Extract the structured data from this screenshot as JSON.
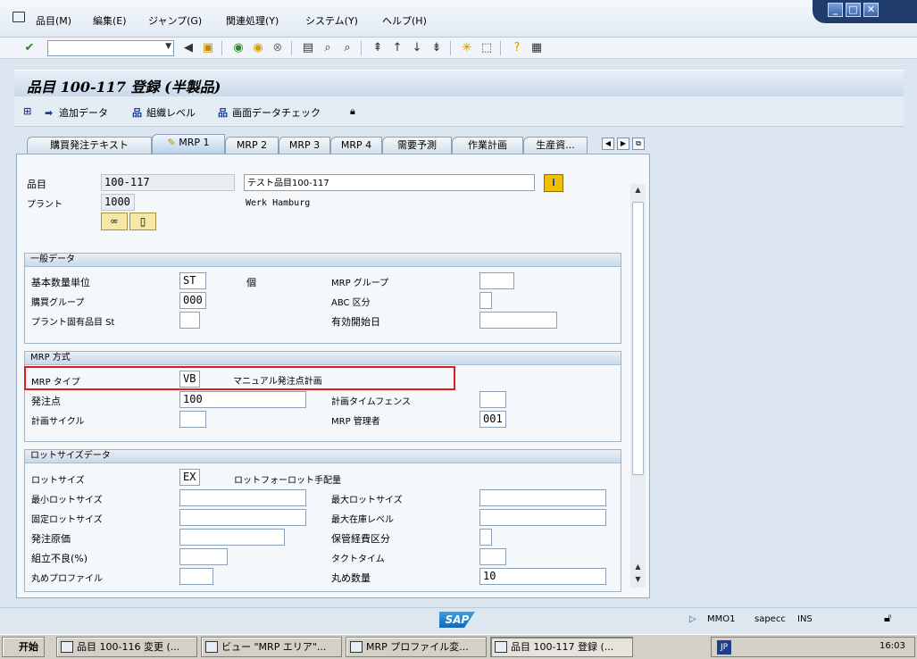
{
  "menu": {
    "items": [
      "品目(M)",
      "編集(E)",
      "ジャンプ(G)",
      "関連処理(Y)",
      "システム(Y)",
      "ヘルプ(H)"
    ]
  },
  "window_controls": {
    "minimize": "_",
    "maximize": "□",
    "close": "✕"
  },
  "toolbar": {
    "command_field_value": ""
  },
  "title": "品目 100-117 登録 (半製品)",
  "app_toolbar": {
    "additional_data": "追加データ",
    "org_levels": "組織レベル",
    "check_screen_data": "画面データチェック"
  },
  "tabs": [
    "購買発注テキスト",
    "MRP 1",
    "MRP 2",
    "MRP 3",
    "MRP 4",
    "需要予測",
    "作業計画",
    "生産資..."
  ],
  "active_tab": "MRP 1",
  "header": {
    "material_label": "品目",
    "material_value": "100-117",
    "material_desc": "テスト品目100-117",
    "plant_label": "プラント",
    "plant_value": "1000",
    "plant_name": "Werk Hamburg"
  },
  "general": {
    "title": "一般データ",
    "base_uom_label": "基本数量単位",
    "base_uom_value": "ST",
    "base_uom_text": "個",
    "mrp_group_label": "MRP グループ",
    "mrp_group_value": "",
    "purch_group_label": "購買グループ",
    "purch_group_value": "000",
    "abc_label": "ABC 区分",
    "abc_value": "",
    "plant_status_label": "プラント固有品目 St",
    "plant_status_value": "",
    "valid_from_label": "有効開始日",
    "valid_from_value": ""
  },
  "mrp": {
    "title": "MRP 方式",
    "mrp_type_label": "MRP タイプ",
    "mrp_type_value": "VB",
    "mrp_type_text": "マニュアル発注点計画",
    "reorder_label": "発注点",
    "reorder_value": "100",
    "time_fence_label": "計画タイムフェンス",
    "time_fence_value": "",
    "plan_cycle_label": "計画サイクル",
    "plan_cycle_value": "",
    "controller_label": "MRP 管理者",
    "controller_value": "001"
  },
  "lot": {
    "title": "ロットサイズデータ",
    "lot_size_label": "ロットサイズ",
    "lot_size_value": "EX",
    "lot_size_text": "ロットフォーロット手配量",
    "min_lot_label": "最小ロットサイズ",
    "min_lot_value": "",
    "max_lot_label": "最大ロットサイズ",
    "max_lot_value": "",
    "fixed_lot_label": "固定ロットサイズ",
    "fixed_lot_value": "",
    "max_stock_label": "最大在庫レベル",
    "max_stock_value": "",
    "order_cost_label": "発注原価",
    "order_cost_value": "",
    "storage_cost_label": "保管経費区分",
    "storage_cost_value": "",
    "assembly_scrap_label": "組立不良(%)",
    "assembly_scrap_value": "",
    "takt_label": "タクトタイム",
    "takt_value": "",
    "rounding_profile_label": "丸めプロファイル",
    "rounding_profile_value": "",
    "rounding_value_label": "丸め数量",
    "rounding_value_value": "10"
  },
  "status": {
    "logo": "SAP",
    "transaction": "MMO1",
    "server": "sapecc",
    "mode": "INS"
  },
  "taskbar": {
    "start": "开始",
    "tasks": [
      "品目 100-116 変更 (...",
      "ビュー \"MRP エリア\"...",
      "MRP プロファイル変...",
      "品目 100-117 登録 (..."
    ],
    "lang": "JP",
    "clock": "16:03"
  }
}
